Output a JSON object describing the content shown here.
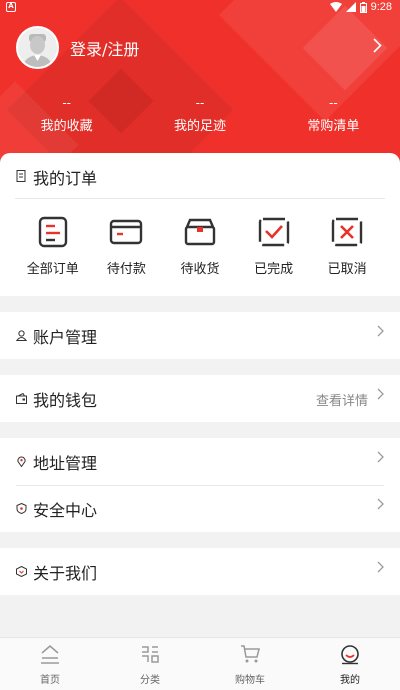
{
  "status_bar": {
    "time": "9:28",
    "icons": [
      "wifi-icon",
      "signal-icon",
      "battery-icon"
    ]
  },
  "profile": {
    "login_label": "登录/注册",
    "avatar_icon": "default-avatar-icon",
    "arrow_icon": "chevron-right-icon"
  },
  "stats": [
    {
      "value": "--",
      "label": "我的收藏"
    },
    {
      "value": "--",
      "label": "我的足迹"
    },
    {
      "value": "--",
      "label": "常购清单"
    }
  ],
  "orders": {
    "title": "我的订单",
    "items": [
      {
        "label": "全部订单",
        "icon": "all-orders-icon"
      },
      {
        "label": "待付款",
        "icon": "pending-payment-icon"
      },
      {
        "label": "待收货",
        "icon": "pending-receipt-icon"
      },
      {
        "label": "已完成",
        "icon": "completed-icon"
      },
      {
        "label": "已取消",
        "icon": "cancelled-icon"
      }
    ]
  },
  "menu": {
    "account": {
      "label": "账户管理",
      "icon": "user-icon"
    },
    "wallet": {
      "label": "我的钱包",
      "extra": "查看详情",
      "icon": "wallet-icon"
    },
    "address": {
      "label": "地址管理",
      "icon": "location-icon"
    },
    "security": {
      "label": "安全中心",
      "icon": "shield-icon"
    },
    "about": {
      "label": "关于我们",
      "icon": "about-icon"
    }
  },
  "tabbar": [
    {
      "label": "首页",
      "icon": "home-icon",
      "active": false
    },
    {
      "label": "分类",
      "icon": "category-icon",
      "active": false
    },
    {
      "label": "购物车",
      "icon": "cart-icon",
      "active": false
    },
    {
      "label": "我的",
      "icon": "profile-icon",
      "active": true
    }
  ],
  "colors": {
    "brand_red": "#f0312b",
    "background": "#f2f2f2"
  }
}
